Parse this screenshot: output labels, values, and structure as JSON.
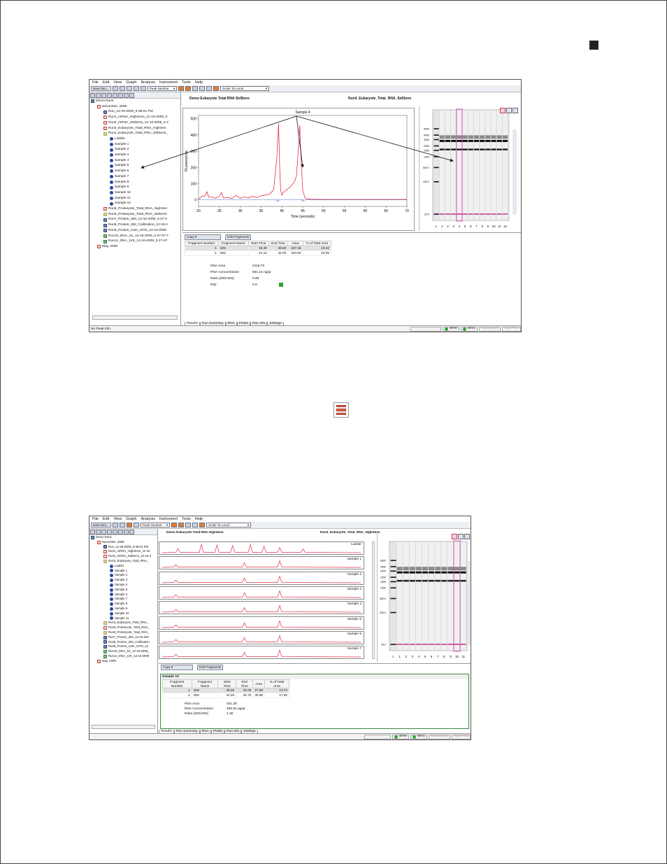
{
  "menu": [
    "File",
    "Edit",
    "View",
    "Graph",
    "Analysis",
    "Instrument",
    "Tools",
    "Help"
  ],
  "toolbar": {
    "new_run": "New Run...",
    "peak_number": "Peak Number",
    "scale": "Scale To Local"
  },
  "status": {
    "message": "No Peak Info",
    "sim0": "Sim0",
    "sim1": "Sim1",
    "auto_export": "Auto Export",
    "auto_print": "Auto Print"
  },
  "tabs": [
    "Results",
    "Run Summary",
    "RNA",
    "Peaks",
    "Run Info",
    "Settings"
  ],
  "copy_label": "Copy",
  "edit_fragments_label": "Edit Fragments",
  "columns": {
    "fragment_number": "Fragment Number",
    "fragment_name": "Fragment Name",
    "start_time": "Start Time",
    "end_time": "End Time",
    "area": "Area",
    "pct_total_area": "% of Total Area"
  },
  "metric_labels": {
    "rna_area": "RNA Area",
    "rna_concentration": "RNA Concentration",
    "ratio": "Ratio [28S/18S]",
    "rqi": "RQI"
  },
  "colors": {
    "trace": "#e0304a",
    "accent": "#e56d2c",
    "gel_highlight": "#d23fb0",
    "rqi_good": "#2fa52f"
  },
  "shot1": {
    "tree": [
      {
        "label": "Demo Runs",
        "level": 0,
        "icon": "folder"
      },
      {
        "label": "December, 2009",
        "level": 1,
        "icon": "calendar"
      },
      {
        "label": "Run_12-29-2009_9-38-01 PM",
        "level": 2,
        "icon": "run-blue"
      },
      {
        "label": "Run1_mRNA_HighSens_12-16-2009_3",
        "level": 2,
        "icon": "run-red"
      },
      {
        "label": "Run2_mRNA_StdSens_12-16-2009_3-2",
        "level": 2,
        "icon": "run-red"
      },
      {
        "label": "Run3_Eukaryote_Total_RNA_HighSen",
        "level": 2,
        "icon": "run-red"
      },
      {
        "label": "Run4_Eukaryote_Total_RNA_StdSens_",
        "level": 2,
        "icon": "run-yellow"
      },
      {
        "label": "Ladder",
        "level": 3,
        "icon": "sample"
      },
      {
        "label": "Sample 1",
        "level": 3,
        "icon": "sample"
      },
      {
        "label": "Sample 2",
        "level": 3,
        "icon": "sample"
      },
      {
        "label": "Sample 3",
        "level": 3,
        "icon": "sample"
      },
      {
        "label": "Sample 4",
        "level": 3,
        "icon": "sample"
      },
      {
        "label": "Sample 5",
        "level": 3,
        "icon": "sample"
      },
      {
        "label": "Sample 6",
        "level": 3,
        "icon": "sample"
      },
      {
        "label": "Sample 7",
        "level": 3,
        "icon": "sample"
      },
      {
        "label": "Sample 8",
        "level": 3,
        "icon": "sample"
      },
      {
        "label": "Sample 9",
        "level": 3,
        "icon": "sample"
      },
      {
        "label": "Sample 10",
        "level": 3,
        "icon": "sample"
      },
      {
        "label": "Sample 11",
        "level": 3,
        "icon": "sample"
      },
      {
        "label": "Sample 12",
        "level": 3,
        "icon": "sample"
      },
      {
        "label": "Run5_Prokaryote_Total_RNA_HighSen",
        "level": 2,
        "icon": "run-red"
      },
      {
        "label": "Run6_Prokaryote_Total_RNA_StdSens",
        "level": 2,
        "icon": "run-yellow"
      },
      {
        "label": "Run7_Protein_260_12-16-2009_3-27-0",
        "level": 2,
        "icon": "run-blue"
      },
      {
        "label": "Run8_Protein_260_Calibration_12-16-2",
        "level": 2,
        "icon": "run-blue"
      },
      {
        "label": "Run9_Protein_User_ISTD_12-16-2009",
        "level": 2,
        "icon": "run-blue"
      },
      {
        "label": "Run10_DNA_1K_12-16-2009_3-27-07 F",
        "level": 2,
        "icon": "run-green"
      },
      {
        "label": "Run11_DNA_12K_12-16-2009_3-27-07",
        "level": 2,
        "icon": "run-green"
      },
      {
        "label": "May, 2009",
        "level": 1,
        "icon": "calendar"
      }
    ],
    "left_title": "Demo Eukaryote Total RNA StdSens",
    "right_title": "Run4_Eukaryote_Total_RNA_StdSens",
    "chart_data": {
      "type": "line",
      "title": "Sample 4",
      "xlabel": "Time (seconds)",
      "ylabel": "Fluorescence",
      "xlim": [
        20,
        70
      ],
      "ylim": [
        -40,
        520
      ],
      "xticks": [
        20,
        25,
        30,
        35,
        40,
        45,
        50,
        55,
        60,
        65,
        70
      ],
      "yticks": [
        0,
        100,
        200,
        300,
        400,
        500
      ],
      "peak_markers": [
        "18",
        "28"
      ],
      "x": [
        20,
        21,
        21.5,
        22,
        22.5,
        23,
        24,
        25,
        25.5,
        26,
        27,
        28,
        29,
        30,
        31,
        32,
        33,
        34,
        35,
        36,
        37,
        38,
        38.8,
        39.2,
        39.5,
        39.7,
        40,
        40.3,
        41,
        42,
        43,
        43.5,
        44,
        44.3,
        44.6,
        45,
        45.5,
        46,
        47,
        50,
        55,
        60,
        65,
        70
      ],
      "values": [
        5,
        25,
        22,
        50,
        15,
        18,
        10,
        22,
        45,
        12,
        15,
        8,
        28,
        10,
        18,
        12,
        22,
        14,
        25,
        30,
        35,
        60,
        260,
        470,
        180,
        60,
        30,
        45,
        60,
        80,
        110,
        150,
        330,
        460,
        250,
        60,
        15,
        6,
        4,
        3,
        3,
        3,
        3,
        3
      ]
    },
    "gel_lanes": [
      "L",
      "1",
      "2",
      "3",
      "4",
      "5",
      "6",
      "7",
      "8",
      "9",
      "10",
      "11",
      "12"
    ],
    "gel_size_labels": [
      "6000",
      "4000",
      "3000",
      "2000",
      "1500",
      "1000",
      "500.0",
      "200.0",
      "25.0"
    ],
    "results": {
      "rows": [
        {
          "n": "1",
          "name": "18S",
          "start": "38.30",
          "end": "39.60",
          "area": "407.46",
          "pct": "19.22"
        },
        {
          "n": "2",
          "name": "28S",
          "start": "44.15",
          "end": "46.00",
          "area": "403.84",
          "pct": "19.05"
        }
      ],
      "rna_area": "2119.76",
      "rna_concentration": "561.14 ng/µl",
      "ratio": "0.99",
      "rqi": "8.9"
    }
  },
  "shot2": {
    "tree": [
      {
        "label": "Demo Runs",
        "level": 0,
        "icon": "folder"
      },
      {
        "label": "December, 2009",
        "level": 1,
        "icon": "calendar"
      },
      {
        "label": "Run_12-29-2009_9-38-01 PM",
        "level": 2,
        "icon": "run-blue"
      },
      {
        "label": "Run1_mRNA_HighSens_11-16",
        "level": 2,
        "icon": "run-red"
      },
      {
        "label": "Run2_mRNA_StdSens_12-16-2",
        "level": 2,
        "icon": "run-red"
      },
      {
        "label": "Run3_Eukaryote_Total_RNA_",
        "level": 2,
        "icon": "run-yellow"
      },
      {
        "label": "Ladder",
        "level": 3,
        "icon": "sample"
      },
      {
        "label": "Sample 1",
        "level": 3,
        "icon": "sample"
      },
      {
        "label": "Sample 2",
        "level": 3,
        "icon": "sample"
      },
      {
        "label": "Sample 3",
        "level": 3,
        "icon": "sample"
      },
      {
        "label": "Sample 4",
        "level": 3,
        "icon": "sample"
      },
      {
        "label": "Sample 5",
        "level": 3,
        "icon": "sample"
      },
      {
        "label": "Sample 6",
        "level": 3,
        "icon": "sample"
      },
      {
        "label": "Sample 7",
        "level": 3,
        "icon": "sample"
      },
      {
        "label": "Sample 8",
        "level": 3,
        "icon": "sample"
      },
      {
        "label": "Sample 9",
        "level": 3,
        "icon": "sample"
      },
      {
        "label": "Sample 10",
        "level": 3,
        "icon": "sample"
      },
      {
        "label": "Sample 11",
        "level": 3,
        "icon": "sample"
      },
      {
        "label": "Run4_Eukaryote_Total_RNA_",
        "level": 2,
        "icon": "run-yellow"
      },
      {
        "label": "Run5_Prokaryote_Total_RNA_",
        "level": 2,
        "icon": "run-red"
      },
      {
        "label": "Run6_Prokaryote_Total_RNA_",
        "level": 2,
        "icon": "run-yellow"
      },
      {
        "label": "Run7_Protein_260_12-16-200",
        "level": 2,
        "icon": "run-blue"
      },
      {
        "label": "Run8_Protein_260_Calibration",
        "level": 2,
        "icon": "run-blue"
      },
      {
        "label": "Run9_Protein_User_ISTD_12",
        "level": 2,
        "icon": "run-blue"
      },
      {
        "label": "Run10_DNA_1K_12-16-2009_",
        "level": 2,
        "icon": "run-green"
      },
      {
        "label": "Run11_DNA_12K_12-16-2009",
        "level": 2,
        "icon": "run-green"
      },
      {
        "label": "May, 2009",
        "level": 1,
        "icon": "calendar"
      }
    ],
    "left_title": "Demo Eukaryote Total RNA HighSens",
    "right_title": "Run3_Eukaryote_Total_RNA_HighSens",
    "traces": [
      "Ladder",
      "Sample 1",
      "Sample 2",
      "Sample 3",
      "Sample 4",
      "Sample 5",
      "Sample 6",
      "Sample 7"
    ],
    "gel_lanes": [
      "L",
      "1",
      "2",
      "3",
      "4",
      "5",
      "6",
      "7",
      "8",
      "9",
      "10",
      "11"
    ],
    "gel_size_labels": [
      "6000",
      "4000",
      "3000",
      "2000",
      "1500",
      "1000",
      "500.0",
      "200.0",
      "25.0"
    ],
    "results": {
      "title": "Sample 10",
      "rows": [
        {
          "n": "1",
          "name": "18S",
          "start": "38.25",
          "end": "40.05",
          "area": "27.68",
          "pct": "13.74"
        },
        {
          "n": "2",
          "name": "28S",
          "start": "44.00",
          "end": "46.70",
          "area": "35.56",
          "pct": "17.65"
        }
      ],
      "rna_area": "201.39",
      "rna_concentration": "466.91 pg/µl",
      "ratio": "1.30"
    }
  }
}
